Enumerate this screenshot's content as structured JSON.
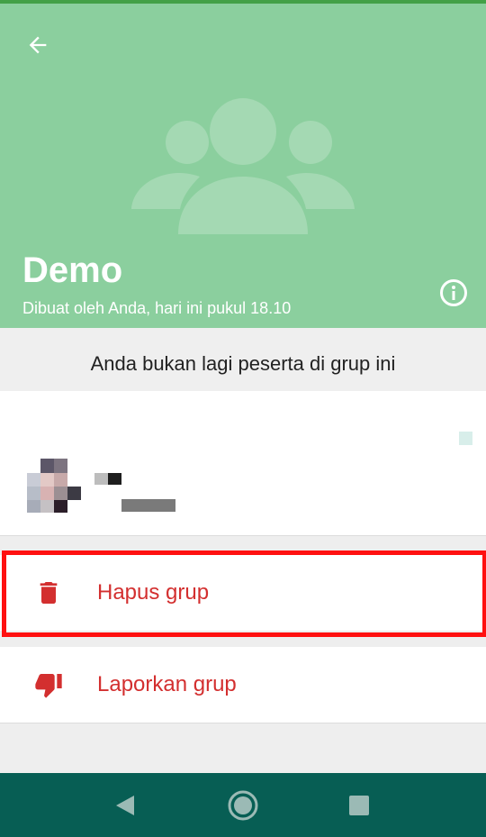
{
  "group": {
    "name": "Demo",
    "created_text": "Dibuat oleh Anda, hari ini pukul 18.10"
  },
  "notice": "Anda bukan lagi peserta di grup ini",
  "actions": {
    "delete_label": "Hapus grup",
    "report_label": "Laporkan grup"
  },
  "icons": {
    "back": "arrow-left-icon",
    "info": "info-icon",
    "delete": "trash-icon",
    "report": "thumbs-down-icon",
    "group_placeholder": "group-icon",
    "nav_back": "triangle-back-icon",
    "nav_home": "circle-home-icon",
    "nav_recents": "square-recents-icon"
  },
  "colors": {
    "header": "#8bcf9e",
    "accent_red": "#d32f2f",
    "navbar": "#075e54",
    "highlight": "#ff1010"
  }
}
